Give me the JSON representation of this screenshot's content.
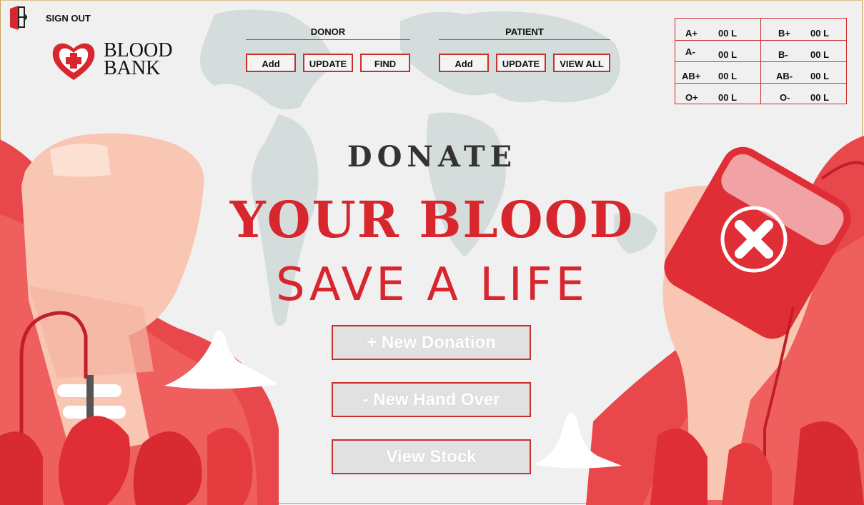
{
  "header": {
    "sign_out_label": "SIGN OUT",
    "brand_line1": "BLOOD",
    "brand_line2": "BANK"
  },
  "donor": {
    "title": "DONOR",
    "buttons": [
      "Add",
      "UPDATE",
      "FIND"
    ]
  },
  "patient": {
    "title": "PATIENT",
    "buttons": [
      "Add",
      "UPDATE",
      "VIEW ALL"
    ]
  },
  "stock": [
    {
      "group": "A+",
      "amount": "00 L"
    },
    {
      "group": "B+",
      "amount": "00 L"
    },
    {
      "group": "A-",
      "amount": "00 L"
    },
    {
      "group": "B-",
      "amount": "00 L"
    },
    {
      "group": "AB+",
      "amount": "00 L"
    },
    {
      "group": "AB-",
      "amount": "00 L"
    },
    {
      "group": "O+",
      "amount": "00 L"
    },
    {
      "group": "O-",
      "amount": "00 L"
    }
  ],
  "hero": {
    "line1": "DONATE",
    "line2": "YOUR BLOOD",
    "line3": "SAVE A LIFE"
  },
  "actions": {
    "new_donation": "+ New Donation",
    "new_hand_over": "- New Hand Over",
    "view_stock": "View Stock"
  },
  "colors": {
    "accent": "#d7262d",
    "button_border": "#c9302c",
    "background": "#f0f0f0"
  }
}
